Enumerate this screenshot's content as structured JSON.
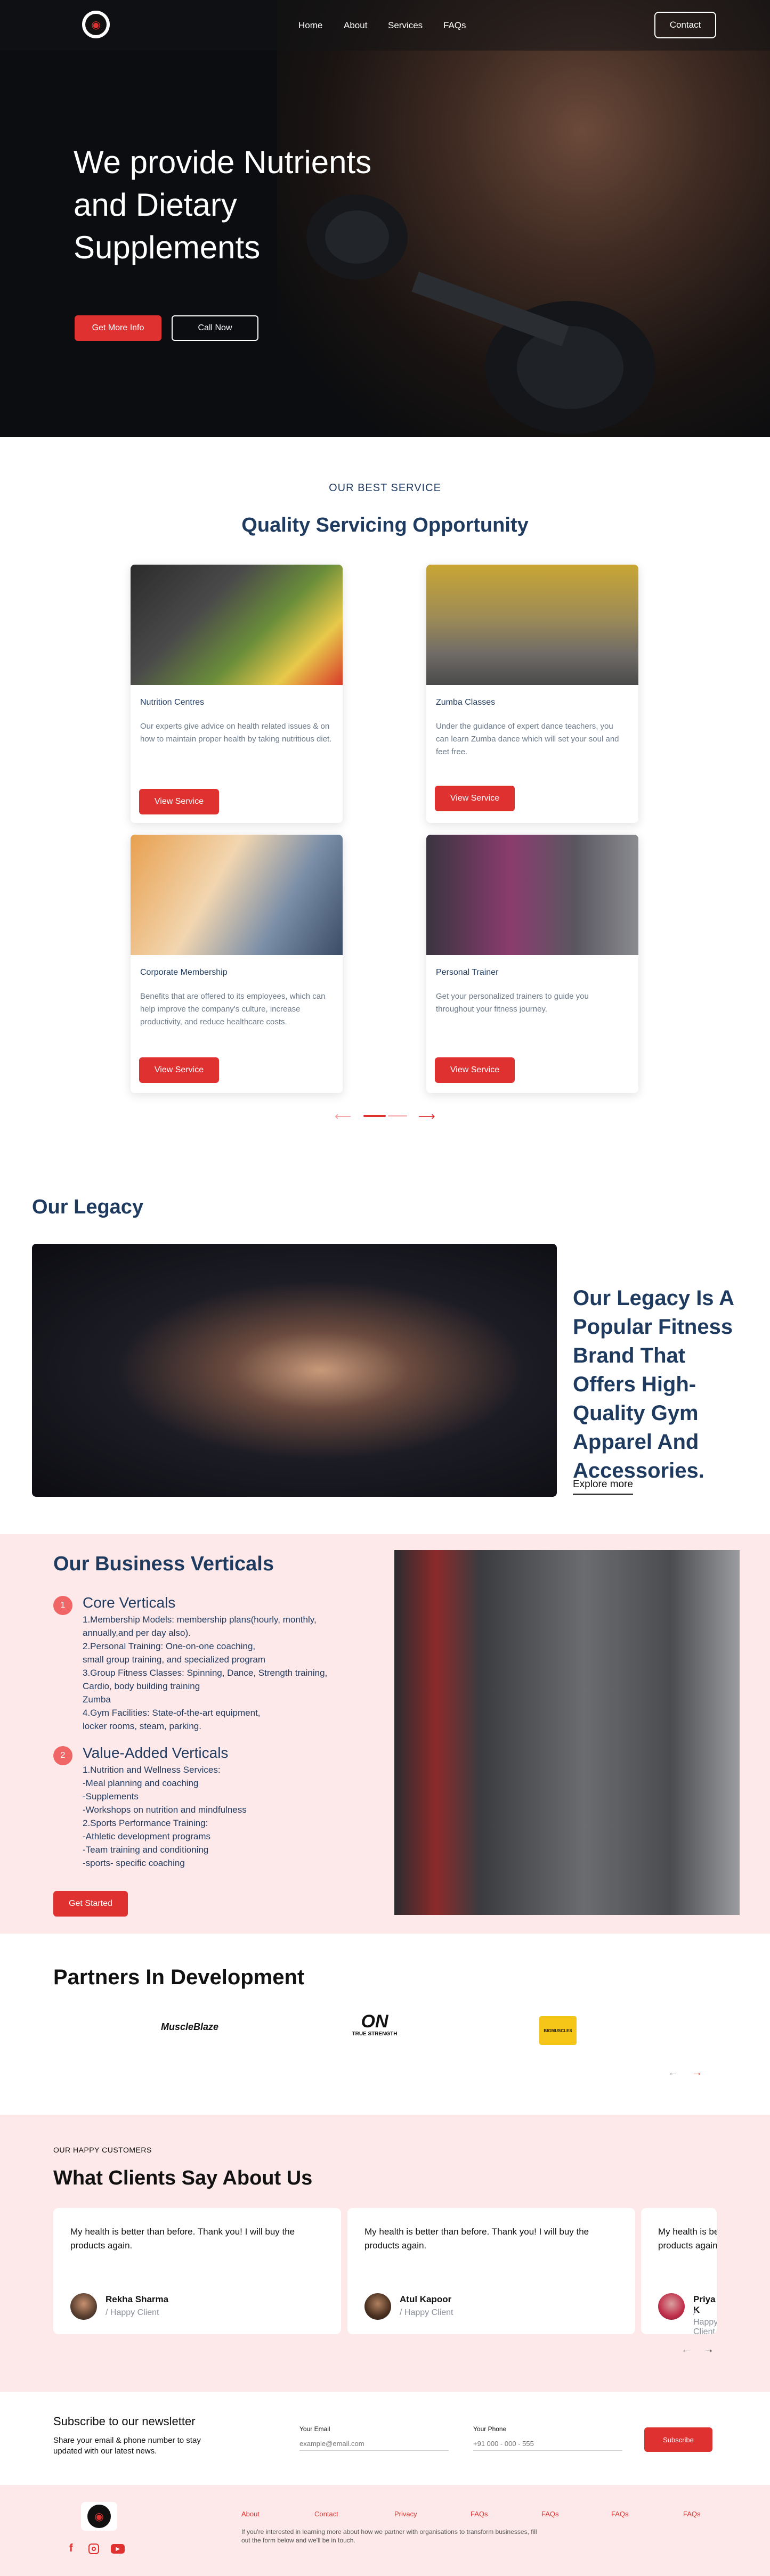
{
  "nav": {
    "links": [
      "Home",
      "About",
      "Services",
      "FAQs"
    ],
    "contact_label": "Contact"
  },
  "hero": {
    "title_lines": [
      "We provide Nutrients",
      "and Dietary",
      "Supplements"
    ],
    "primary_label": "Get More Info",
    "secondary_label": "Call Now"
  },
  "services": {
    "kicker": "OUR BEST SERVICE",
    "title": "Quality Servicing Opportunity",
    "cards": [
      {
        "title": "Nutrition Centres",
        "desc": "Our experts give advice on health related issues & on how to maintain proper health by taking nutritious diet.",
        "button": "View Service"
      },
      {
        "title": "Zumba Classes",
        "desc": "Under the guidance of expert dance teachers, you can learn Zumba dance which will set your soul and feet free.",
        "button": "View Service"
      },
      {
        "title": "Corporate Membership",
        "desc": "Benefits that are offered to its employees, which can help improve the company's culture, increase productivity, and reduce healthcare costs.",
        "button": "View Service"
      },
      {
        "title": "Personal Trainer",
        "desc": "Get your personalized trainers to guide you throughout your fitness journey.",
        "button": "View Service"
      }
    ]
  },
  "legacy": {
    "heading": "Our Legacy",
    "text": "Our Legacy Is A Popular Fitness Brand That Offers High-Quality Gym Apparel And Accessories.",
    "link": "Explore more"
  },
  "verticals": {
    "title": "Our Business Verticals",
    "items": [
      {
        "num": "1",
        "title": "Core Verticals",
        "body": "1.Membership Models:  membership plans(hourly, monthly, annually,and per day also).\n2.Personal Training: One-on-one coaching,\nsmall group training, and specialized program\n3.Group Fitness Classes: Spinning, Dance, Strength training, Cardio, body building training\nZumba\n4.Gym Facilities: State-of-the-art equipment,\nlocker rooms, steam, parking."
      },
      {
        "num": "2",
        "title": "Value-Added Verticals",
        "body": "1.Nutrition and Wellness Services:\n-Meal planning and coaching\n-Supplements\n-Workshops on nutrition and mindfulness\n2.Sports Performance Training:\n-Athletic development programs\n-Team training and conditioning\n-sports- specific coaching"
      }
    ],
    "button": "Get Started"
  },
  "partners": {
    "title": "Partners In Development",
    "logos": [
      "MuscleBlaze",
      "ON",
      "TRUE STRENGTH",
      "BIGMUSCLES"
    ]
  },
  "testimonials": {
    "kicker": "OUR HAPPY CUSTOMERS",
    "title": "What Clients Say About Us",
    "items": [
      {
        "quote": "My health is better than before. Thank you! I will buy the products again.",
        "name": "Rekha Sharma",
        "role": "/ Happy Client"
      },
      {
        "quote": "My health is better than before. Thank you! I will buy the products again.",
        "name": "Atul Kapoor",
        "role": "/ Happy Client"
      },
      {
        "quote": "My health is better than before. Thank you! I will buy the products again.",
        "name": "Priya K",
        "role": "/ Happy Client"
      }
    ]
  },
  "newsletter": {
    "title": "Subscribe to our newsletter",
    "subtitle": "Share your email & phone number to stay updated with our latest news.",
    "email_label": "Your Email",
    "email_placeholder": "example@email.com",
    "phone_label": "Your Phone",
    "phone_placeholder": "+91 000 - 000 - 555",
    "button": "Subscribe"
  },
  "footer": {
    "links": [
      "About",
      "Contact",
      "Privacy",
      "FAQs",
      "FAQs",
      "FAQs",
      "FAQs"
    ],
    "note": "If you're interested in learning more about how we partner with organisations to transform businesses, fill out the form below and we'll be in touch."
  },
  "colors": {
    "accent": "#e03131",
    "navy": "#1f3a5f",
    "pink_bg": "#fde9e9"
  }
}
